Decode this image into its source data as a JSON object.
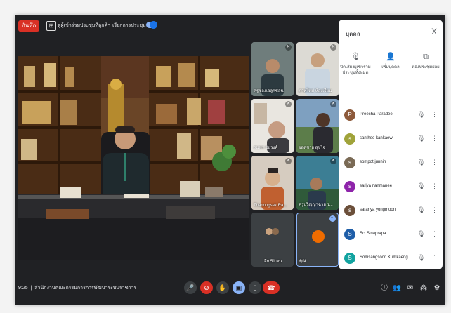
{
  "topbar": {
    "record_label": "บันทึก",
    "menu_item_1": "ดูผู้เข้าร่วมประชุมที่ลูกค้า",
    "menu_item_2": "เรียกการประชุม"
  },
  "main_video": {
    "subject": "presenter-at-desk"
  },
  "grid": {
    "tiles": [
      {
        "name": "ครูซองเอลูกชอน"
      },
      {
        "name": "ภาพใหม่ ห้องเรียน"
      },
      {
        "name": "สมพร ชัยวงศ์"
      },
      {
        "name": "ยอดชาย สุขใจ"
      },
      {
        "name": "Thanongsak Ra..."
      },
      {
        "name": "ครูปริญญาฉาย ร..."
      },
      {
        "name": "อีก 51 คน"
      },
      {
        "name": "คุณ"
      }
    ]
  },
  "bottombar": {
    "time": "9:25",
    "meeting_title": "สำนักงานคณะกรรมการการพัฒนาระบบราชการ"
  },
  "panel": {
    "title": "บุคคล",
    "close": "X",
    "actions": [
      {
        "label": "ปิดเสียงผู้เข้าร่วมประชุมทั้งหมด",
        "icon": "mute-all-icon"
      },
      {
        "label": "เพิ่มบุคคล",
        "icon": "add-person-icon"
      },
      {
        "label": "ห้องประชุมย่อย",
        "icon": "breakout-icon"
      }
    ],
    "participants": [
      {
        "name": "Preecha Paradee",
        "color": "#8d5a3b",
        "initial": "P"
      },
      {
        "name": "santhee kankaew",
        "color": "#a0a33a",
        "initial": "s"
      },
      {
        "name": "sompot junnin",
        "color": "#7a6a55",
        "initial": "s"
      },
      {
        "name": "sariya nanmanee",
        "color": "#8e24aa",
        "initial": "s"
      },
      {
        "name": "saranya yongmoon",
        "color": "#6b4f3a",
        "initial": "s"
      },
      {
        "name": "Sci Sinaprapa",
        "color": "#1e5ea8",
        "initial": "S"
      },
      {
        "name": "Somsangsoon Kumkaeng",
        "color": "#12a3a0",
        "initial": "S"
      }
    ]
  }
}
